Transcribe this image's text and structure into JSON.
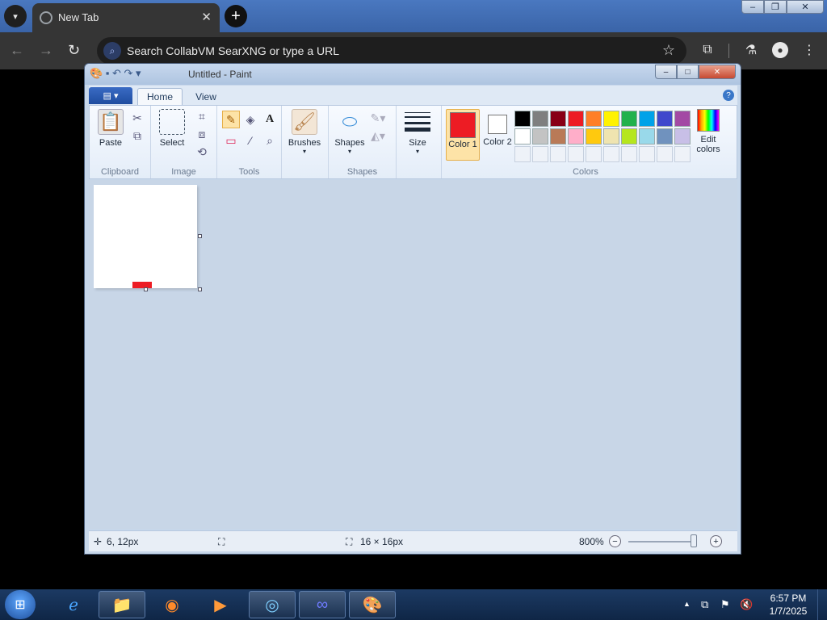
{
  "browser": {
    "tab": {
      "title": "New Tab"
    },
    "omnibox": {
      "text": "Search CollabVM SearXNG or type a URL"
    }
  },
  "paint": {
    "window_title": "Untitled - Paint",
    "tabs": [
      "Home",
      "View"
    ],
    "groups": {
      "clipboard": {
        "label": "Clipboard",
        "paste": "Paste"
      },
      "image": {
        "label": "Image",
        "select": "Select"
      },
      "tools": {
        "label": "Tools"
      },
      "brushes": {
        "label": "Brushes"
      },
      "shapes": {
        "label": "Shapes",
        "shapes": "Shapes"
      },
      "size": {
        "label": "Size"
      },
      "colors": {
        "label": "Colors",
        "color1": "Color 1",
        "color2": "Color 2",
        "edit": "Edit colors",
        "color1_value": "#ed1c24",
        "color2_value": "#ffffff",
        "palette_row1": [
          "#000000",
          "#7f7f7f",
          "#880015",
          "#ed1c24",
          "#ff7f27",
          "#fff200",
          "#22b14c",
          "#00a2e8",
          "#3f48cc",
          "#a349a4"
        ],
        "palette_row2": [
          "#ffffff",
          "#c3c3c3",
          "#b97a57",
          "#ffaec9",
          "#ffc90e",
          "#efe4b0",
          "#b5e61d",
          "#99d9ea",
          "#7092be",
          "#c8bfe7"
        ]
      }
    },
    "status": {
      "position": "6, 12px",
      "size": "16 × 16px",
      "zoom": "800%",
      "zoom_fraction": 1.0
    }
  },
  "taskbar": {
    "clock_time": "6:57 PM",
    "clock_date": "1/7/2025"
  }
}
